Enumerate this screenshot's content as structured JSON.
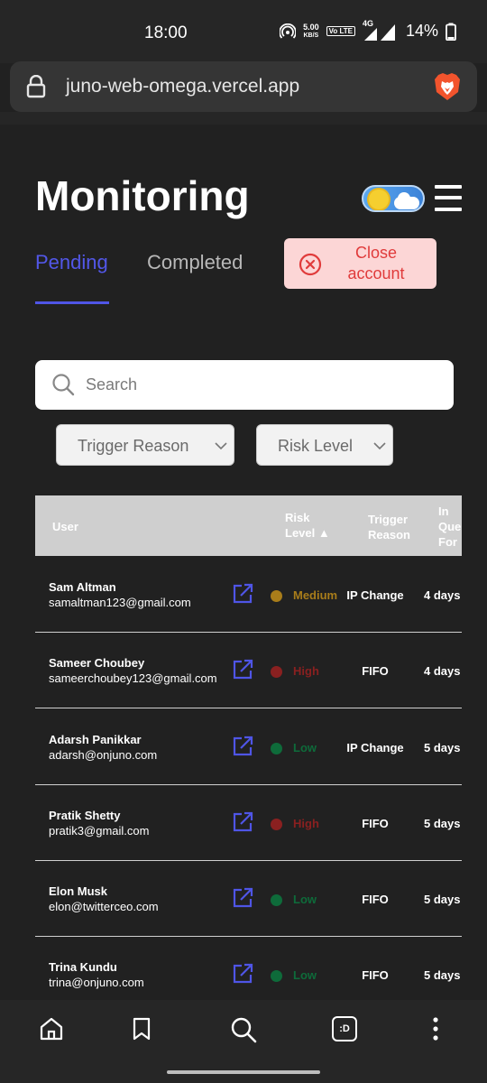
{
  "status_bar": {
    "time": "18:00",
    "speed_value": "5.00",
    "speed_unit": "KB/S",
    "volte_label": "Vo LTE",
    "network": "4G",
    "battery": "14%"
  },
  "browser": {
    "url": "juno-web-omega.vercel.app"
  },
  "page": {
    "title": "Monitoring",
    "tabs": [
      {
        "label": "Pending",
        "active": true
      },
      {
        "label": "Completed",
        "active": false
      }
    ],
    "close_account_label": "Close account",
    "search_placeholder": "Search",
    "filters": {
      "trigger_reason": "Trigger Reason",
      "risk_level": "Risk Level"
    }
  },
  "table": {
    "headers": {
      "user": "User",
      "risk_line1": "Risk",
      "risk_line2": "Level ▲",
      "trigger_line1": "Trigger",
      "trigger_line2": "Reason",
      "queue_line1": "In",
      "queue_line2": "Queue",
      "queue_line3": "For"
    },
    "rows": [
      {
        "name": "Sam Altman",
        "email": "samaltman123@gmail.com",
        "risk": "Medium",
        "risk_color": "#a97d1a",
        "trigger": "IP Change",
        "queue": "4 days"
      },
      {
        "name": "Sameer Choubey",
        "email": "sameerchoubey123@gmail.com",
        "risk": "High",
        "risk_color": "#8a2020",
        "trigger": "FIFO",
        "queue": "4 days"
      },
      {
        "name": "Adarsh Panikkar",
        "email": "adarsh@onjuno.com",
        "risk": "Low",
        "risk_color": "#0e6b3a",
        "trigger": "IP Change",
        "queue": "5 days"
      },
      {
        "name": "Pratik Shetty",
        "email": "pratik3@gmail.com",
        "risk": "High",
        "risk_color": "#8a2020",
        "trigger": "FIFO",
        "queue": "5 days"
      },
      {
        "name": "Elon Musk",
        "email": "elon@twitterceo.com",
        "risk": "Low",
        "risk_color": "#0e6b3a",
        "trigger": "FIFO",
        "queue": "5 days"
      },
      {
        "name": "Trina Kundu",
        "email": "trina@onjuno.com",
        "risk": "Low",
        "risk_color": "#0e6b3a",
        "trigger": "FIFO",
        "queue": "5 days"
      }
    ]
  },
  "bottom_nav": {
    "items": [
      "home-icon",
      "bookmark-icon",
      "search-icon",
      "tab-switcher-icon",
      "more-icon"
    ],
    "tab_switcher_label": ":D"
  },
  "colors": {
    "accent": "#4f55e6",
    "danger": "#e03b3b",
    "background": "#212121"
  }
}
